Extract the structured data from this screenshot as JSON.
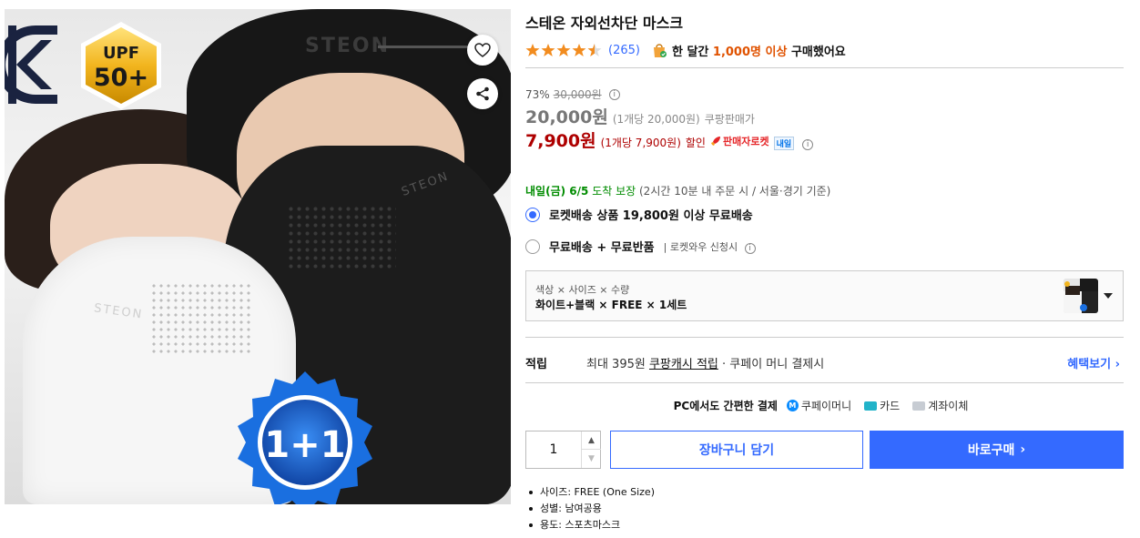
{
  "product": {
    "title": "스테온 자외선차단 마스크",
    "review_count": "(265)",
    "rating": 4.5,
    "purchase_prefix": "한 달간",
    "purchase_highlight": "1,000명 이상",
    "purchase_suffix": "구매했어요"
  },
  "image": {
    "brand_text": "STEON",
    "upf_line1": "UPF",
    "upf_line2": "50+",
    "promo_badge": "1+1"
  },
  "price": {
    "discount_rate": "73%",
    "original_price": "30,000원",
    "wholesale_price": "20,000원",
    "wholesale_unit": "(1개당 20,000원)",
    "wholesale_label": "쿠팡판매가",
    "sale_price": "7,900원",
    "sale_unit": "(1개당 7,900원)",
    "sale_label": "할인",
    "rocket_label": "판매자로켓",
    "naeil_badge": "내일"
  },
  "delivery": {
    "date": "내일(금) 6/5",
    "guarantee": "도착 보장",
    "condition": "(2시간 10분 내 주문 시 / 서울·경기 기준)"
  },
  "shipping_options": [
    {
      "label": "로켓배송 상품 19,800원 이상 무료배송",
      "note": "",
      "selected": true
    },
    {
      "label": "무료배송 + 무료반품",
      "note": "로켓와우 신청시",
      "selected": false
    }
  ],
  "option_selector": {
    "label": "색상 × 사이즈 × 수량",
    "value": "화이트+블랙 × FREE × 1세트"
  },
  "reward": {
    "key": "적립",
    "prefix": "최대 395원",
    "link": "쿠팡캐시 적립",
    "suffix": "· 쿠페이 머니 결제시",
    "more": "혜택보기"
  },
  "payment": {
    "lead": "PC에서도 간편한 결제",
    "coupay": "쿠페이머니",
    "card": "카드",
    "bank": "계좌이체"
  },
  "purchase": {
    "quantity": "1",
    "cart_label": "장바구니 담기",
    "buy_label": "바로구매"
  },
  "specs": [
    "사이즈: FREE (One Size)",
    "성별: 남여공용",
    "용도: 스포츠마스크"
  ],
  "colors": {
    "accent": "#346aff",
    "sale_red": "#ae0000",
    "highlight_orange": "#e05200",
    "delivery_green": "#008c00"
  }
}
